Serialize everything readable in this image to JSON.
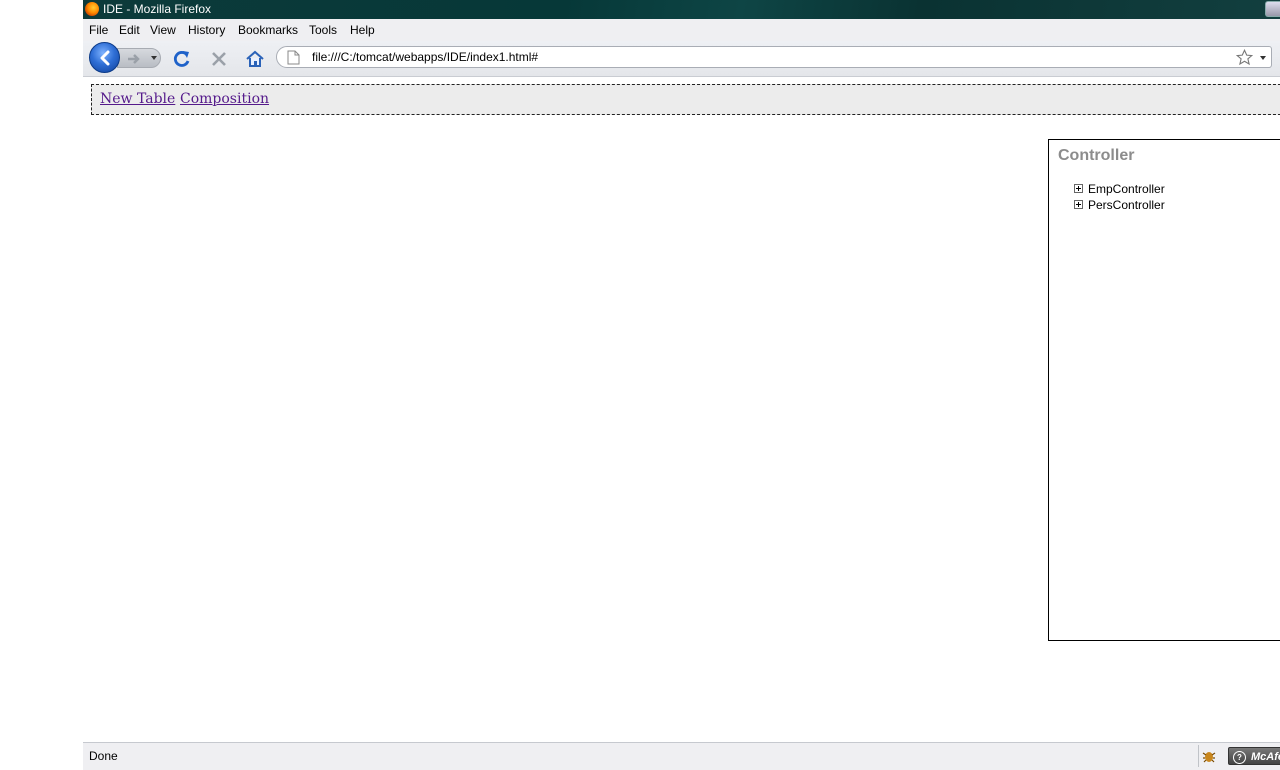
{
  "window": {
    "title": "IDE - Mozilla Firefox"
  },
  "menu": {
    "items": [
      "File",
      "Edit",
      "View",
      "History",
      "Bookmarks",
      "Tools",
      "Help"
    ]
  },
  "toolbar": {
    "icons": [
      "back-icon",
      "forward-icon",
      "reload-icon",
      "stop-icon",
      "home-icon",
      "page-icon",
      "bookmark-star-icon"
    ]
  },
  "urlbar": {
    "value": "file:///C:/tomcat/webapps/IDE/index1.html#"
  },
  "page": {
    "links": [
      "New Table",
      "Composition"
    ],
    "controller": {
      "title": "Controller",
      "items": [
        "EmpController",
        "PersController"
      ]
    }
  },
  "status": {
    "text": "Done",
    "mcafee_label": "McAfee"
  },
  "colors": {
    "link_visited": "#551a8b",
    "panel_title": "#8c8c8c",
    "titlebar": "#063838"
  }
}
